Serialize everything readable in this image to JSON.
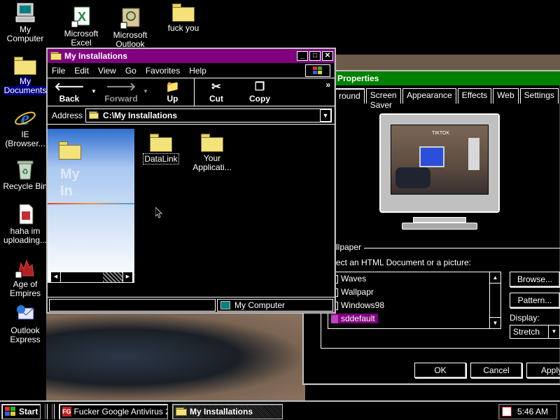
{
  "desktop": {
    "icons": [
      {
        "label_lines": [
          "My",
          "Computer"
        ]
      },
      {
        "label_lines": [
          "Microsoft",
          "Excel"
        ]
      },
      {
        "label_lines": [
          "Microsoft",
          "Outlook"
        ]
      },
      {
        "label_lines": [
          "fuck you"
        ]
      },
      {
        "label_lines": [
          "My",
          "Documents"
        ]
      },
      {
        "label_lines": [
          "IE",
          "(Browser..."
        ]
      },
      {
        "label_lines": [
          "Recycle Bin"
        ]
      },
      {
        "label_lines": [
          "haha im",
          "uploading..."
        ]
      },
      {
        "label_lines": [
          "Age of",
          "Empires"
        ]
      },
      {
        "label_lines": [
          "Outlook",
          "Express"
        ]
      }
    ]
  },
  "explorer": {
    "title": "My Installations",
    "menu": [
      "File",
      "Edit",
      "View",
      "Go",
      "Favorites",
      "Help"
    ],
    "toolbar": {
      "back": "Back",
      "forward": "Forward",
      "up": "Up",
      "cut": "Cut",
      "copy": "Copy",
      "more": "»"
    },
    "address_label": "Address",
    "address_value": "C:\\My Installations",
    "sidebar_watermark_lines": [
      "My",
      "In"
    ],
    "items": [
      {
        "label_lines": [
          "DataLink"
        ]
      },
      {
        "label_lines": [
          "Your",
          "Applicati..."
        ]
      }
    ],
    "status_right": "My Computer"
  },
  "display_properties": {
    "title": "Properties",
    "tabs": [
      "round",
      "Screen Saver",
      "Appearance",
      "Effects",
      "Web",
      "Settings"
    ],
    "wallpaper_group": "llpaper",
    "instruction": "ect an HTML Document or a picture:",
    "list": [
      "Waves",
      "Wallpapr",
      "Windows98",
      "sddefault"
    ],
    "selected_item": "sddefault",
    "browse": "Browse...",
    "pattern": "Pattern...",
    "display_label": "Display:",
    "display_value": "Stretch",
    "ok": "OK",
    "cancel": "Cancel",
    "apply": "Apply",
    "monitor_preview_text": "TIKTOK"
  },
  "taskbar": {
    "start": "Start",
    "tasks": [
      "Fucker Google Antivirus 2...",
      "My Installations"
    ],
    "clock": "5:46 AM"
  },
  "colors": {
    "title_active": "#800080",
    "title_inactive": "#008000",
    "selection": "#800080",
    "folder": "#f4e27a"
  }
}
